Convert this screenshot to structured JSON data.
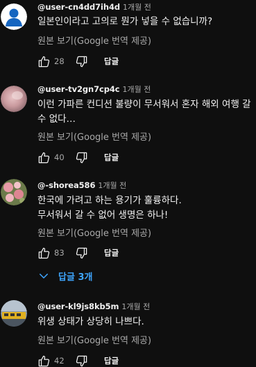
{
  "comments": [
    {
      "handle": "@user-cn4dd7ih4d",
      "time": "1개월 전",
      "text": "일본인이라고 고의로 뭔가 넣을 수 없습니까?",
      "translate": "원본 보기(Google 번역 제공)",
      "likes": "28",
      "reply": "답글",
      "avatar": "default-user-avatar"
    },
    {
      "handle": "@user-tv2gn7cp4c",
      "time": "1개월 전",
      "text": "이런 가파른 컨디션 불량이 무서워서 혼자 해외 여행 갈 수 없다…",
      "translate": "원본 보기(Google 번역 제공)",
      "likes": "40",
      "reply": "답글",
      "avatar": "pink-blur-avatar"
    },
    {
      "handle": "@-shorea586",
      "time": "1개월 전",
      "text_lines": [
        "한국에 가려고 하는 용기가 훌륭하다.",
        "무서워서 갈 수 없어 생명은 하나!"
      ],
      "translate": "원본 보기(Google 번역 제공)",
      "likes": "83",
      "reply": "답글",
      "replies_toggle": "답글 3개",
      "avatar": "flower-avatar"
    },
    {
      "handle": "@user-kl9js8kb5m",
      "time": "1개월 전",
      "text": "위생 상태가 상당히 나쁘다.",
      "translate": "원본 보기(Google 번역 제공)",
      "likes": "42",
      "reply": "답글",
      "avatar": "train-avatar"
    }
  ],
  "colors": {
    "background": "#0f0f0f",
    "text": "#f1f1f1",
    "secondary": "#aaaaaa",
    "link": "#3ea6ff"
  }
}
